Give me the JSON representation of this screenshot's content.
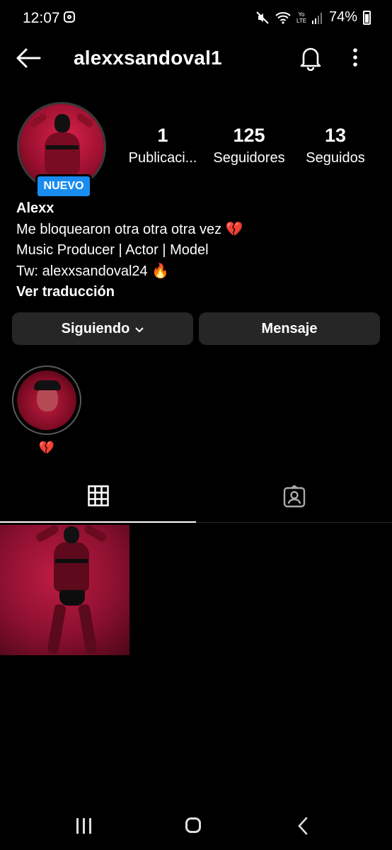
{
  "status_bar": {
    "time": "12:07",
    "network_label": "Yo LTE",
    "battery": "74%"
  },
  "header": {
    "username": "alexxsandoval1"
  },
  "profile": {
    "badge": "NUEVO",
    "stats": [
      {
        "value": "1",
        "label": "Publicaci..."
      },
      {
        "value": "125",
        "label": "Seguidores"
      },
      {
        "value": "13",
        "label": "Seguidos"
      }
    ],
    "name": "Alexx",
    "bio_line1": "Me bloquearon otra otra otra vez",
    "bio_line2": "Music Producer | Actor | Model",
    "bio_line3": "Tw: alexxsandoval24",
    "heart_emoji": "💔",
    "fire_emoji": "🔥",
    "translate_link": "Ver traducción"
  },
  "actions": {
    "following_label": "Siguiendo",
    "message_label": "Mensaje"
  },
  "highlights": [
    {
      "label": "💔"
    }
  ],
  "tabs": [
    {
      "icon": "grid-icon",
      "active": true
    },
    {
      "icon": "tagged-icon",
      "active": false
    }
  ],
  "colors": {
    "background": "#000000",
    "button_bg": "#262626",
    "badge_blue": "#1a8cf0"
  }
}
